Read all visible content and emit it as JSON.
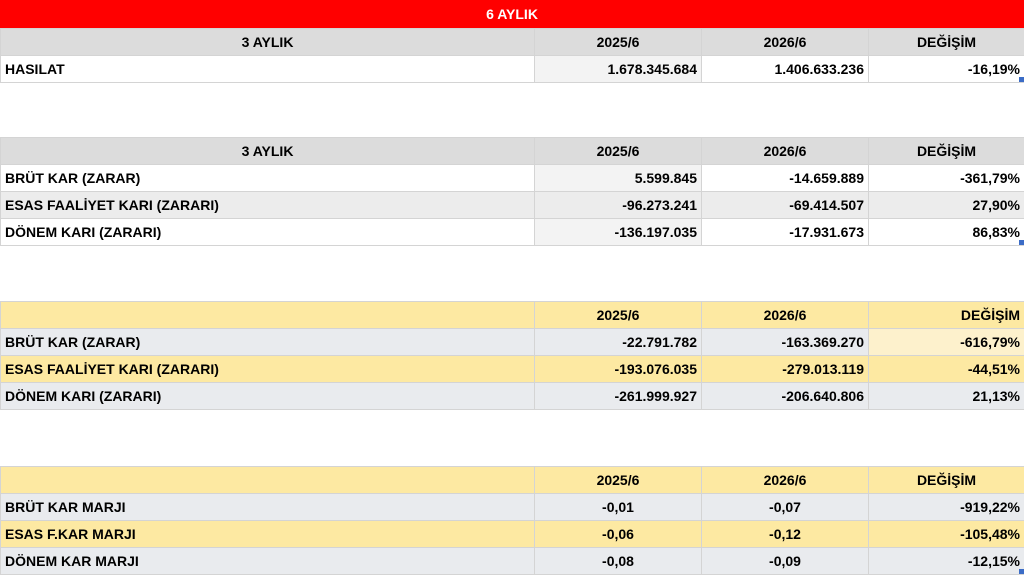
{
  "title": "6 AYLIK",
  "table1": {
    "header": [
      "3 AYLIK",
      "2025/6",
      "2026/6",
      "DEĞİŞİM"
    ],
    "rows": [
      {
        "label": "HASILAT",
        "v1": "1.678.345.684",
        "v2": "1.406.633.236",
        "chg": "-16,19%"
      }
    ]
  },
  "table2": {
    "header": [
      "3 AYLIK",
      "2025/6",
      "2026/6",
      "DEĞİŞİM"
    ],
    "rows": [
      {
        "label": "BRÜT KAR (ZARAR)",
        "v1": "5.599.845",
        "v2": "-14.659.889",
        "chg": "-361,79%"
      },
      {
        "label": "ESAS FAALİYET KARI (ZARARI)",
        "v1": "-96.273.241",
        "v2": "-69.414.507",
        "chg": "27,90%"
      },
      {
        "label": "DÖNEM KARI (ZARARI)",
        "v1": "-136.197.035",
        "v2": "-17.931.673",
        "chg": "86,83%"
      }
    ]
  },
  "table3": {
    "header": [
      "",
      "2025/6",
      "2026/6",
      "DEĞİŞİM"
    ],
    "rows": [
      {
        "label": "BRÜT KAR (ZARAR)",
        "v1": "-22.791.782",
        "v2": "-163.369.270",
        "chg": "-616,79%"
      },
      {
        "label": "ESAS FAALİYET KARI (ZARARI)",
        "v1": "-193.076.035",
        "v2": "-279.013.119",
        "chg": "-44,51%"
      },
      {
        "label": "DÖNEM KARI (ZARARI)",
        "v1": "-261.999.927",
        "v2": "-206.640.806",
        "chg": "21,13%"
      }
    ]
  },
  "table4": {
    "header": [
      "",
      "2025/6",
      "2026/6",
      "DEĞİŞİM"
    ],
    "rows": [
      {
        "label": "BRÜT KAR MARJI",
        "v1": "-0,01",
        "v2": "-0,07",
        "chg": "-919,22%"
      },
      {
        "label": "ESAS F.KAR MARJI",
        "v1": "-0,06",
        "v2": "-0,12",
        "chg": "-105,48%"
      },
      {
        "label": "DÖNEM KAR MARJI",
        "v1": "-0,08",
        "v2": "-0,09",
        "chg": "-12,15%"
      }
    ]
  },
  "colors": {
    "title_bg": "#ff0000",
    "header_gray": "#dcdcdc",
    "header_yellow": "#fde9a2",
    "row_gray": "#e9ebee"
  }
}
